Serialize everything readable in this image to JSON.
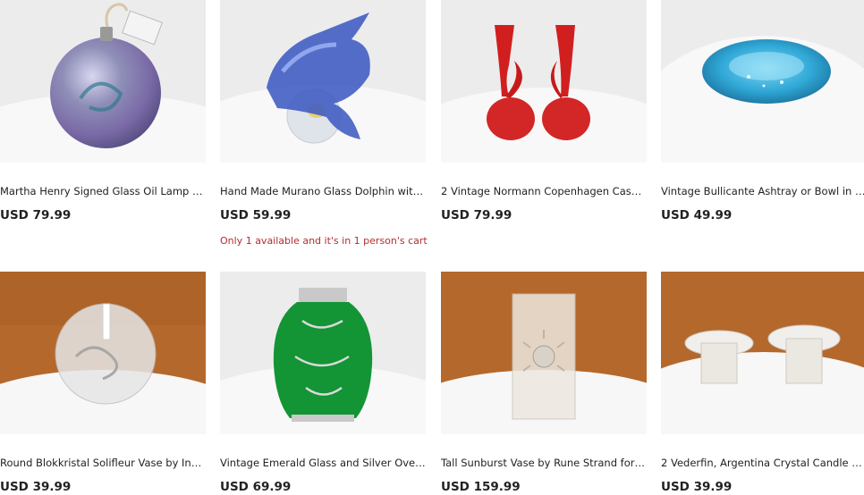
{
  "listings": [
    {
      "title": "Martha Henry Signed Glass Oil Lamp - ...",
      "price": "USD 79.99",
      "image": "iridescent-glass-oil-lamp",
      "stock_notice": ""
    },
    {
      "title": "Hand Made Murano Glass Dolphin with ...",
      "price": "USD 59.99",
      "image": "blue-glass-dolphin",
      "stock_notice": "Only 1 available and it's in 1 person's cart"
    },
    {
      "title": "2 Vintage Normann Copenhagen Case...",
      "price": "USD 79.99",
      "image": "red-glass-candle-holders",
      "stock_notice": ""
    },
    {
      "title": "Vintage Bullicante Ashtray or Bowl in A...",
      "price": "USD 49.99",
      "image": "blue-glass-ashtray",
      "stock_notice": ""
    },
    {
      "title": "Round Blokkristal Solifleur Vase by Ingr...",
      "price": "USD 39.99",
      "image": "round-crystal-solifleur-vase",
      "stock_notice": ""
    },
    {
      "title": "Vintage Emerald Glass and Silver Overl...",
      "price": "USD 69.99",
      "image": "emerald-silver-overlay-vase",
      "stock_notice": ""
    },
    {
      "title": "Tall Sunburst Vase by Rune Strand for S...",
      "price": "USD 159.99",
      "image": "sunburst-crystal-vase",
      "stock_notice": ""
    },
    {
      "title": "2 Vederfin, Argentina Crystal Candle H...",
      "price": "USD 39.99",
      "image": "crystal-candle-holders",
      "stock_notice": ""
    }
  ],
  "colors": {
    "text": "#222222",
    "stock_notice": "#b32d2e",
    "studio_backdrop": "#ececec",
    "wood_backdrop": "#b5682c",
    "white_pedestal": "#f7f7f7"
  }
}
